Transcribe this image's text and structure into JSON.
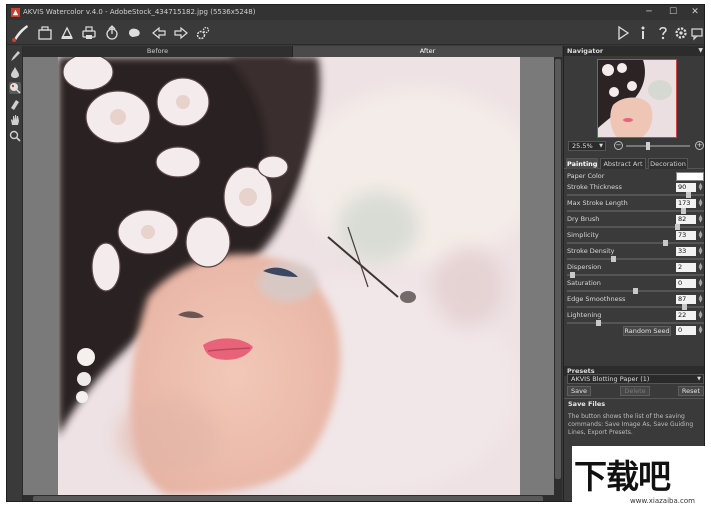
{
  "window": {
    "title": "AKVIS Watercolor v.4.0 - AdobeStock_434715182.jpg (5536x5248)",
    "minimize": "─",
    "maximize": "☐",
    "close": "✕"
  },
  "toolbar": {
    "left_icons": [
      "watercolor-logo-icon",
      "open-icon",
      "save-icon",
      "print-icon",
      "share-icon",
      "plugin-icon",
      "undo-arrow-icon",
      "redo-arrow-icon",
      "settings-gears-icon"
    ],
    "right_icons": [
      "run-icon",
      "info-icon",
      "help-icon",
      "preferences-icon",
      "feedback-icon"
    ]
  },
  "left_tools": [
    "brush-tool-icon",
    "drop-tool-icon",
    "paint-tool-icon",
    "eraser-tool-icon",
    "hand-tool-icon",
    "zoom-tool-icon"
  ],
  "view_tabs": {
    "before": "Before",
    "after": "After",
    "active": "after"
  },
  "navigator": {
    "title": "Navigator",
    "zoom": "25.5%",
    "zoom_out": "−",
    "zoom_in": "+",
    "zoom_level_fraction": 0.33
  },
  "settings_tabs": {
    "painting": "Painting",
    "abstract_art": "Abstract Art",
    "decoration": "Decoration",
    "active": "painting"
  },
  "parameters": {
    "paper_color": {
      "label": "Paper Color",
      "color": "#ffffff"
    },
    "stroke_thickness": {
      "label": "Stroke Thickness",
      "value": "90",
      "fraction": 0.9
    },
    "max_stroke_length": {
      "label": "Max Stroke Length",
      "value": "173",
      "fraction": 0.86
    },
    "dry_brush": {
      "label": "Dry Brush",
      "value": "82",
      "fraction": 0.82
    },
    "simplicity": {
      "label": "Simplicity",
      "value": "73",
      "fraction": 0.73
    },
    "stroke_density": {
      "label": "Stroke Density",
      "value": "33",
      "fraction": 0.33
    },
    "dispersion": {
      "label": "Dispersion",
      "value": "2",
      "fraction": 0.02
    },
    "saturation": {
      "label": "Saturation",
      "value": "0",
      "fraction": 0.5
    },
    "edge_smoothness": {
      "label": "Edge Smoothness",
      "value": "87",
      "fraction": 0.87
    },
    "lightening": {
      "label": "Lightening",
      "value": "22",
      "fraction": 0.22
    },
    "random_seed": {
      "label": "Random Seed",
      "value": "0"
    }
  },
  "presets": {
    "title": "Presets",
    "selected": "AKVIS Blotting Paper (1)",
    "save": "Save",
    "delete": "Delete",
    "reset": "Reset"
  },
  "hint": {
    "title": "Save Files",
    "text": "The button shows the list of the saving commands: Save Image As, Save Guiding Lines, Export Presets."
  },
  "watermark": {
    "logo": "下载吧",
    "url": "www.xiazaiba.com"
  },
  "colors": {
    "app_bg": "#3a3a3a",
    "panel_head": "#2c2c2c",
    "accent_red": "#d04040"
  }
}
